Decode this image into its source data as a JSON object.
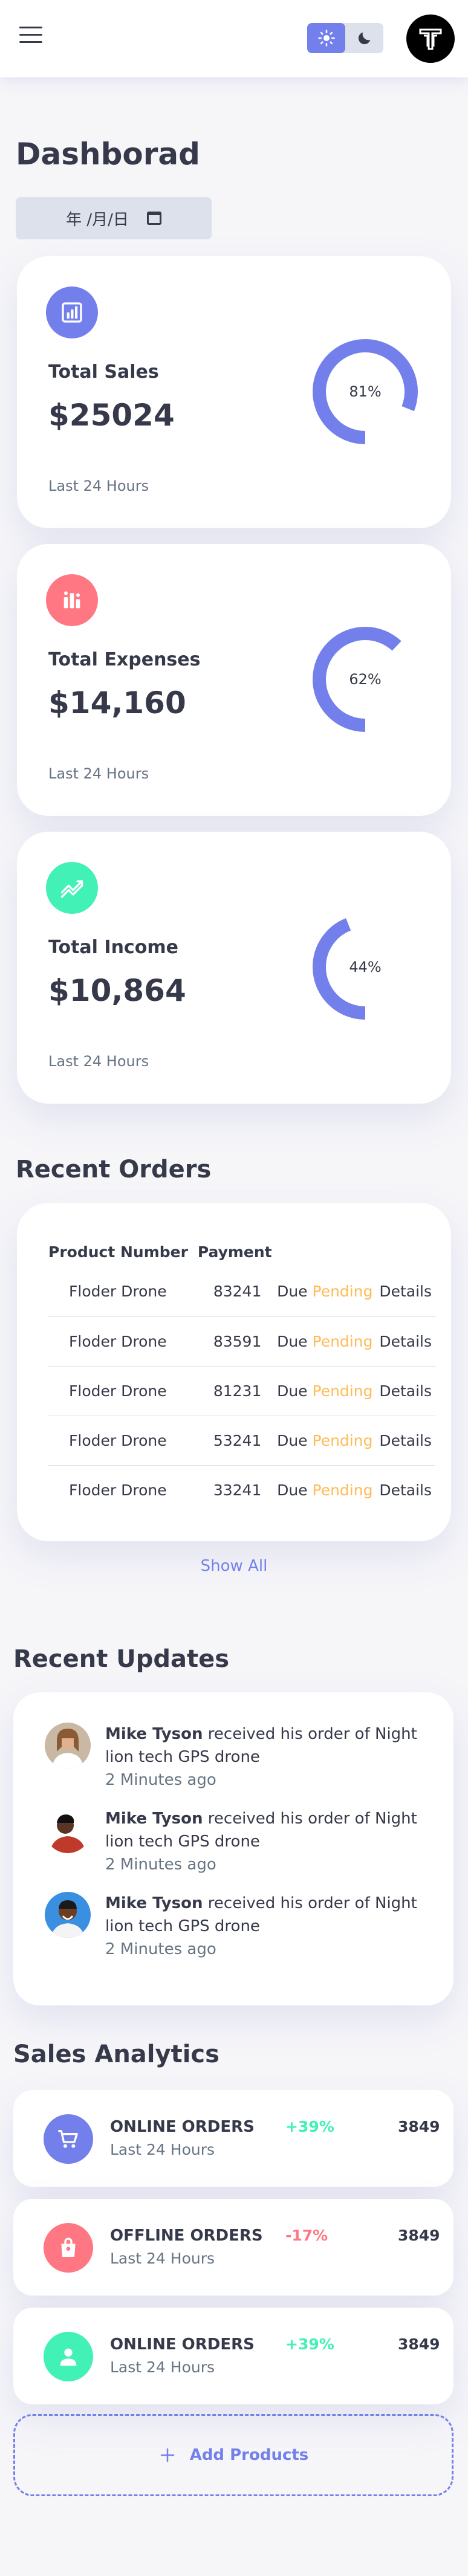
{
  "header": {
    "menu_icon": "menu-icon",
    "theme": {
      "light_icon": "sun-icon",
      "dark_icon": "moon-icon",
      "active": "light"
    },
    "logo_text": "T"
  },
  "dashboard": {
    "title": "Dashborad",
    "date_placeholder": "年 /月/日"
  },
  "insights": [
    {
      "icon": "bar-chart-icon",
      "color": "#7380ec",
      "label": "Total Sales",
      "value": "$25024",
      "percent": "81%",
      "progress": 0.81,
      "period": "Last 24 Hours"
    },
    {
      "icon": "stacked-bars-icon",
      "color": "#ff7782",
      "label": "Total Expenses",
      "value": "$14,160",
      "percent": "62%",
      "progress": 0.62,
      "period": "Last 24 Hours"
    },
    {
      "icon": "trending-up-icon",
      "color": "#41f1b6",
      "label": "Total Income",
      "value": "$10,864",
      "percent": "44%",
      "progress": 0.44,
      "period": "Last 24 Hours"
    }
  ],
  "recent_orders": {
    "title": "Recent Orders",
    "columns": [
      "Product Number",
      "Payment"
    ],
    "rows": [
      {
        "product": "Floder Drone",
        "number": "83241",
        "payment": "Due",
        "status": "Pending",
        "action": "Details"
      },
      {
        "product": "Floder Drone",
        "number": "83591",
        "payment": "Due",
        "status": "Pending",
        "action": "Details"
      },
      {
        "product": "Floder Drone",
        "number": "81231",
        "payment": "Due",
        "status": "Pending",
        "action": "Details"
      },
      {
        "product": "Floder Drone",
        "number": "53241",
        "payment": "Due",
        "status": "Pending",
        "action": "Details"
      },
      {
        "product": "Floder Drone",
        "number": "33241",
        "payment": "Due",
        "status": "Pending",
        "action": "Details"
      }
    ],
    "show_all": "Show All"
  },
  "recent_updates": {
    "title": "Recent Updates",
    "items": [
      {
        "name": "Mike Tyson",
        "message": "received his order of Night lion tech GPS drone",
        "time": "2 Minutes ago"
      },
      {
        "name": "Mike Tyson",
        "message": "received his order of Night lion tech GPS drone",
        "time": "2 Minutes ago"
      },
      {
        "name": "Mike Tyson",
        "message": "received his order of Night lion tech GPS drone",
        "time": "2 Minutes ago"
      }
    ]
  },
  "sales_analytics": {
    "title": "Sales Analytics",
    "items": [
      {
        "icon": "shopping-cart-icon",
        "color": "#7380ec",
        "title": "ONLINE ORDERS",
        "period": "Last 24 Hours",
        "change": "+39%",
        "trend": "positive",
        "count": "3849"
      },
      {
        "icon": "shopping-bag-icon",
        "color": "#ff7782",
        "title": "OFFLINE ORDERS",
        "period": "Last 24 Hours",
        "change": "-17%",
        "trend": "negative",
        "count": "3849"
      },
      {
        "icon": "person-icon",
        "color": "#41f1b6",
        "title": "ONLINE ORDERS",
        "period": "Last 24 Hours",
        "change": "+39%",
        "trend": "positive",
        "count": "3849"
      }
    ],
    "add_products": "Add Products"
  }
}
